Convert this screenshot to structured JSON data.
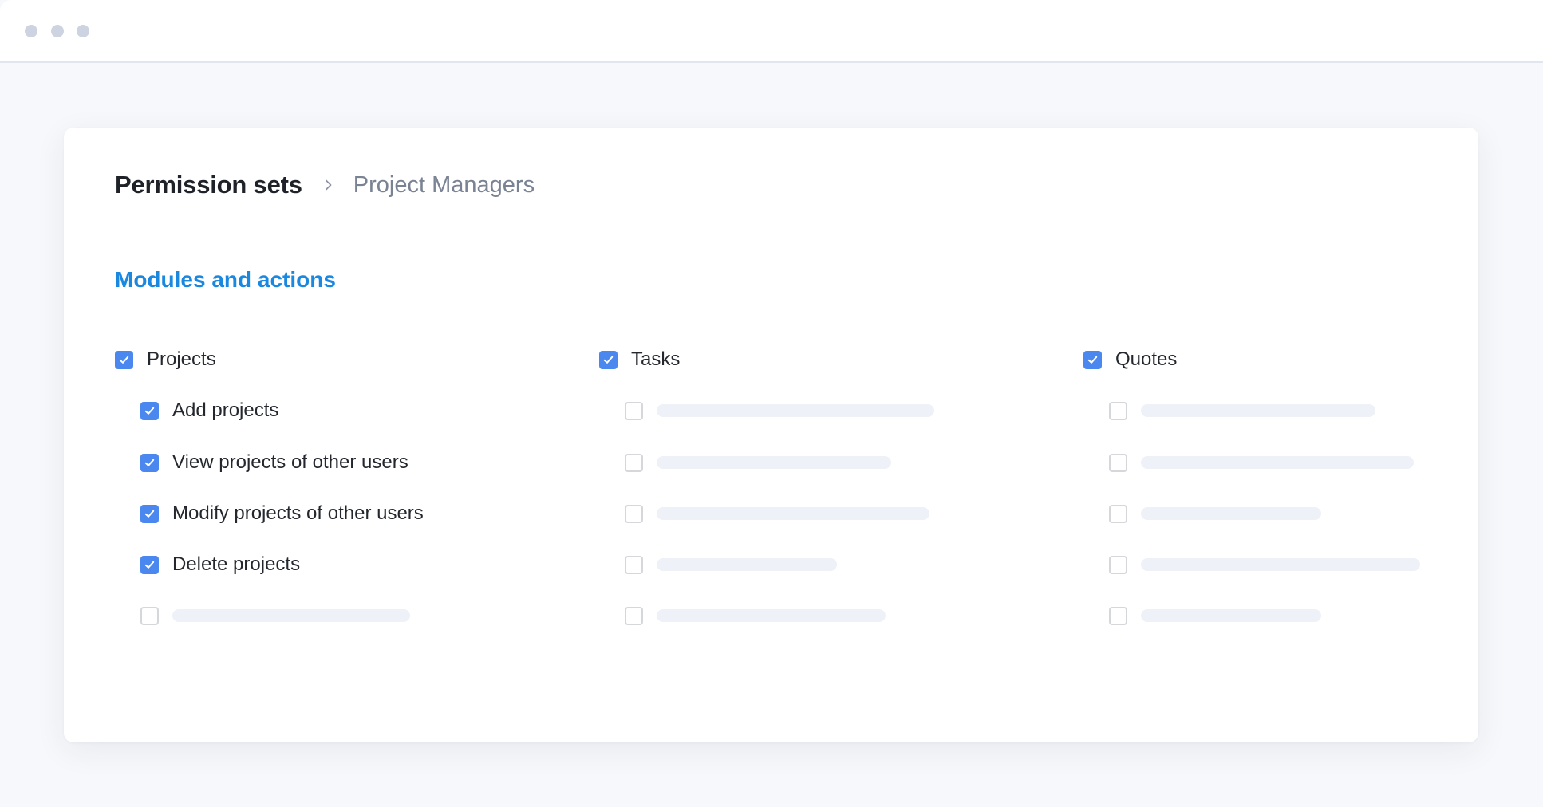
{
  "window": {
    "controls": [
      "dot",
      "dot",
      "dot"
    ],
    "colors": {
      "dot": "#cdd3e0",
      "background": "#f7f8fb"
    }
  },
  "breadcrumb": {
    "root": "Permission sets",
    "separator_icon": "chevron-right-icon",
    "current": "Project Managers"
  },
  "section": {
    "title": "Modules and actions",
    "accent_color": "#1b88e0"
  },
  "checkbox_color": "#4a87ee",
  "modules": [
    {
      "name": "Projects",
      "checked": true,
      "actions": [
        {
          "label": "Add projects",
          "checked": true
        },
        {
          "label": "View projects of other users",
          "checked": true
        },
        {
          "label": "Modify projects of other users",
          "checked": true
        },
        {
          "label": "Delete projects",
          "checked": true
        },
        {
          "label": null,
          "checked": false,
          "placeholder": true
        }
      ]
    },
    {
      "name": "Tasks",
      "checked": true,
      "actions": [
        {
          "label": null,
          "checked": false,
          "placeholder": true
        },
        {
          "label": null,
          "checked": false,
          "placeholder": true
        },
        {
          "label": null,
          "checked": false,
          "placeholder": true
        },
        {
          "label": null,
          "checked": false,
          "placeholder": true
        },
        {
          "label": null,
          "checked": false,
          "placeholder": true
        }
      ]
    },
    {
      "name": "Quotes",
      "checked": true,
      "actions": [
        {
          "label": null,
          "checked": false,
          "placeholder": true
        },
        {
          "label": null,
          "checked": false,
          "placeholder": true
        },
        {
          "label": null,
          "checked": false,
          "placeholder": true
        },
        {
          "label": null,
          "checked": false,
          "placeholder": true
        },
        {
          "label": null,
          "checked": false,
          "placeholder": true
        }
      ]
    }
  ]
}
